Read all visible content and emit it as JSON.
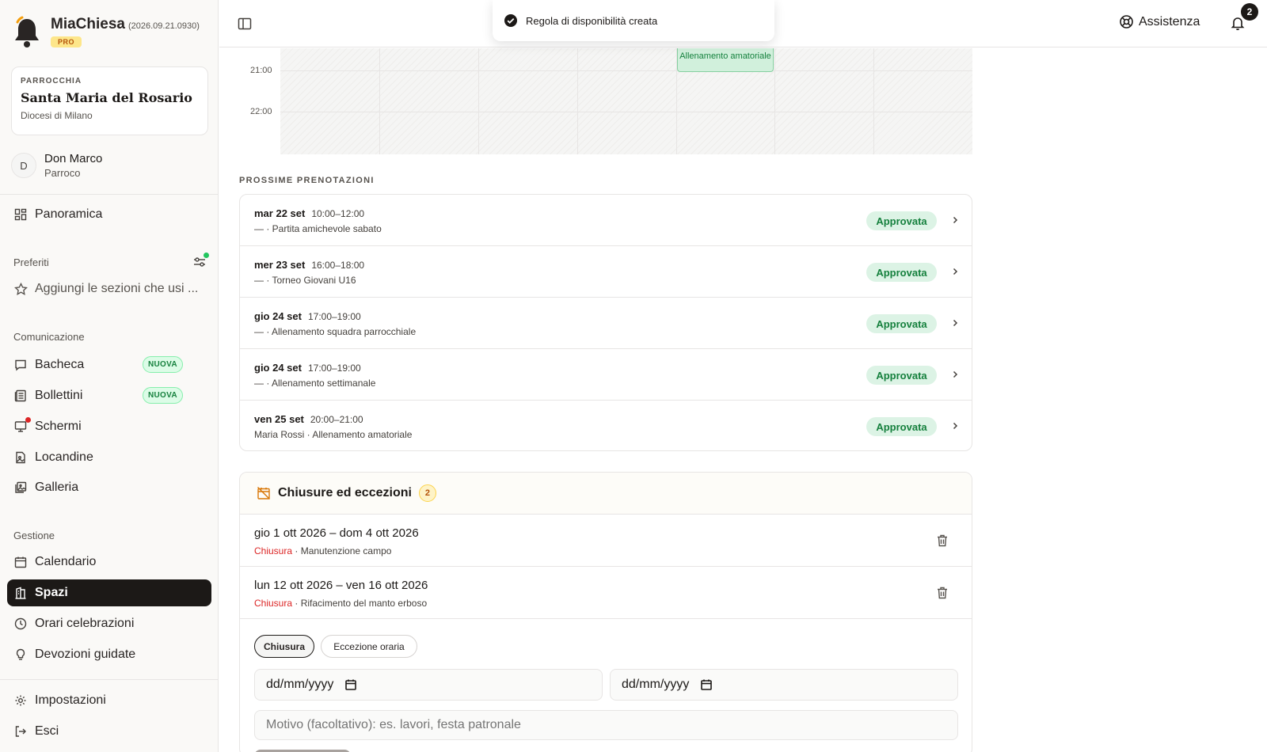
{
  "brand": {
    "name": "MiaChiesa",
    "version": "(2026.09.21.0930)",
    "plan": "PRO"
  },
  "parish": {
    "kicker": "PARROCCHIA",
    "name": "Santa Maria del Rosario",
    "diocese": "Diocesi di Milano"
  },
  "user": {
    "initial": "D",
    "name": "Don Marco",
    "role": "Parroco"
  },
  "nav": {
    "overview": "Panoramica",
    "favorites_title": "Preferiti",
    "favorites_add": "Aggiungi le sezioni che usi ...",
    "communication_title": "Comunicazione",
    "communication": [
      {
        "label": "Bacheca",
        "badge": "NUOVA"
      },
      {
        "label": "Bollettini",
        "badge": "NUOVA"
      },
      {
        "label": "Schermi"
      },
      {
        "label": "Locandine"
      },
      {
        "label": "Galleria"
      }
    ],
    "management_title": "Gestione",
    "management": [
      {
        "label": "Calendario"
      },
      {
        "label": "Spazi",
        "active": true
      },
      {
        "label": "Orari celebrazioni"
      },
      {
        "label": "Devozioni guidate"
      }
    ],
    "settings": "Impostazioni",
    "logout": "Esci"
  },
  "topbar": {
    "help": "Assistenza",
    "notifications": "2"
  },
  "toast": {
    "message": "Regola di disponibilità creata"
  },
  "calendar": {
    "times": [
      "21:00",
      "22:00"
    ],
    "event": {
      "title": "Allenamento amatoriale"
    }
  },
  "bookings": {
    "title": "PROSSIME PRENOTAZIONI",
    "items": [
      {
        "date": "mar 22 set",
        "time": "10:00–12:00",
        "desc": "— · Partita amichevole sabato",
        "status": "Approvata"
      },
      {
        "date": "mer 23 set",
        "time": "16:00–18:00",
        "desc": "— · Torneo Giovani U16",
        "status": "Approvata"
      },
      {
        "date": "gio 24 set",
        "time": "17:00–19:00",
        "desc": "— · Allenamento squadra parrocchiale",
        "status": "Approvata"
      },
      {
        "date": "gio 24 set",
        "time": "17:00–19:00",
        "desc": "— · Allenamento settimanale",
        "status": "Approvata"
      },
      {
        "date": "ven 25 set",
        "time": "20:00–21:00",
        "desc": "Maria Rossi · Allenamento amatoriale",
        "status": "Approvata"
      }
    ]
  },
  "closures": {
    "title": "Chiusure ed eccezioni",
    "count": "2",
    "items": [
      {
        "range": "gio 1 ott 2026 – dom 4 ott 2026",
        "type": "Chiusura",
        "reason": " · Manutenzione campo"
      },
      {
        "range": "lun 12 ott 2026 – ven 16 ott 2026",
        "type": "Chiusura",
        "reason": " · Rifacimento del manto erboso"
      }
    ],
    "form": {
      "type_options": [
        "Chiusura",
        "Eccezione oraria"
      ],
      "date_from_placeholder": "dd/mm/yyyy",
      "date_to_placeholder": "dd/mm/yyyy",
      "reason_placeholder": "Motivo (facoltativo): es. lavori, festa patronale"
    }
  },
  "colors": {
    "accent": "#1c1917",
    "success": "#15803d",
    "danger": "#dc2626",
    "warning": "#b45309"
  }
}
